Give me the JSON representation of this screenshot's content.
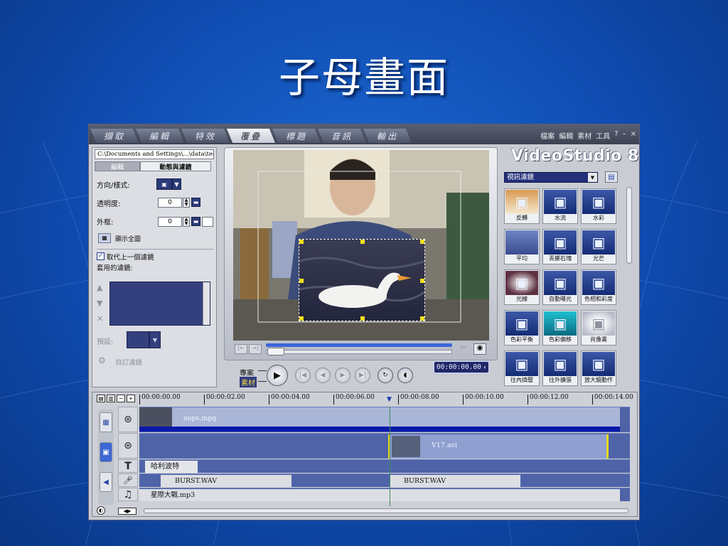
{
  "slide": {
    "title": "子母畫面"
  },
  "steps": [
    {
      "label": "擷取",
      "active": false
    },
    {
      "label": "編輯",
      "active": false
    },
    {
      "label": "特效",
      "active": false
    },
    {
      "label": "覆疊",
      "active": true
    },
    {
      "label": "標題",
      "active": false
    },
    {
      "label": "音訊",
      "active": false
    },
    {
      "label": "輸出",
      "active": false
    }
  ],
  "menus": [
    "檔案",
    "編輯",
    "素材",
    "工具",
    "?",
    "–",
    "×"
  ],
  "left_panel": {
    "path": "C:\\Documents and Settings\\...\\data\\test.VSP",
    "tabs": [
      "編輯",
      "動態與濾鏡"
    ],
    "direction_label": "方向/樣式:",
    "opacity_label": "透明度:",
    "opacity_value": "0",
    "border_label": "外框:",
    "border_value": "0",
    "show_all_label": "顯示全圖",
    "replace_filter_label": "取代上一個濾鏡",
    "applied_filters_label": "套用的濾鏡:",
    "preset_label": "預設:",
    "custom_filter_label": "自訂濾鏡"
  },
  "player": {
    "project_label": "專案",
    "clip_label": "素材",
    "timecode": "00:00:00.00",
    "play_icon": "▶"
  },
  "right_panel": {
    "logo": "VideoStudio 8",
    "category": "視訊濾鏡",
    "filters": [
      {
        "label": "反轉",
        "icon": "▣"
      },
      {
        "label": "水流",
        "icon": "▣"
      },
      {
        "label": "水彩",
        "icon": "▣"
      },
      {
        "label": "平均",
        "icon": "▣"
      },
      {
        "label": "丟擲石塊",
        "icon": "▣"
      },
      {
        "label": "光芒",
        "icon": "▣"
      },
      {
        "label": "光線",
        "icon": "▣"
      },
      {
        "label": "自動曝光",
        "icon": "▣"
      },
      {
        "label": "色相和彩度",
        "icon": "▣"
      },
      {
        "label": "色彩平衡",
        "icon": "▣"
      },
      {
        "label": "色彩偏移",
        "icon": "▣"
      },
      {
        "label": "肖像畫",
        "icon": "▣"
      },
      {
        "label": "往內擠壓",
        "icon": "▣"
      },
      {
        "label": "往外擴張",
        "icon": "▣"
      },
      {
        "label": "放大鏡動作",
        "icon": "▣"
      }
    ]
  },
  "timeline": {
    "ticks": [
      "00:00:00.00",
      "00:00:02.00",
      "00:00:04.00",
      "00:00:06.00",
      "00:00:08.00",
      "00:00:10.00",
      "00:00:12.00",
      "00:00:14.00"
    ],
    "video_clip": "oops.mpg",
    "overlay_clip": "V17.avi",
    "title_clip": "哈利波特",
    "voice_clip_1": "BURST.WAV",
    "voice_clip_2": "BURST.WAV",
    "music_clip": "星際大戰.mp3"
  },
  "colors": {
    "slide_bg": "#1258c0",
    "accent_blue": "#3c66d4",
    "track_blue": "#4f64a8",
    "overlay_border": "#e8d820"
  }
}
